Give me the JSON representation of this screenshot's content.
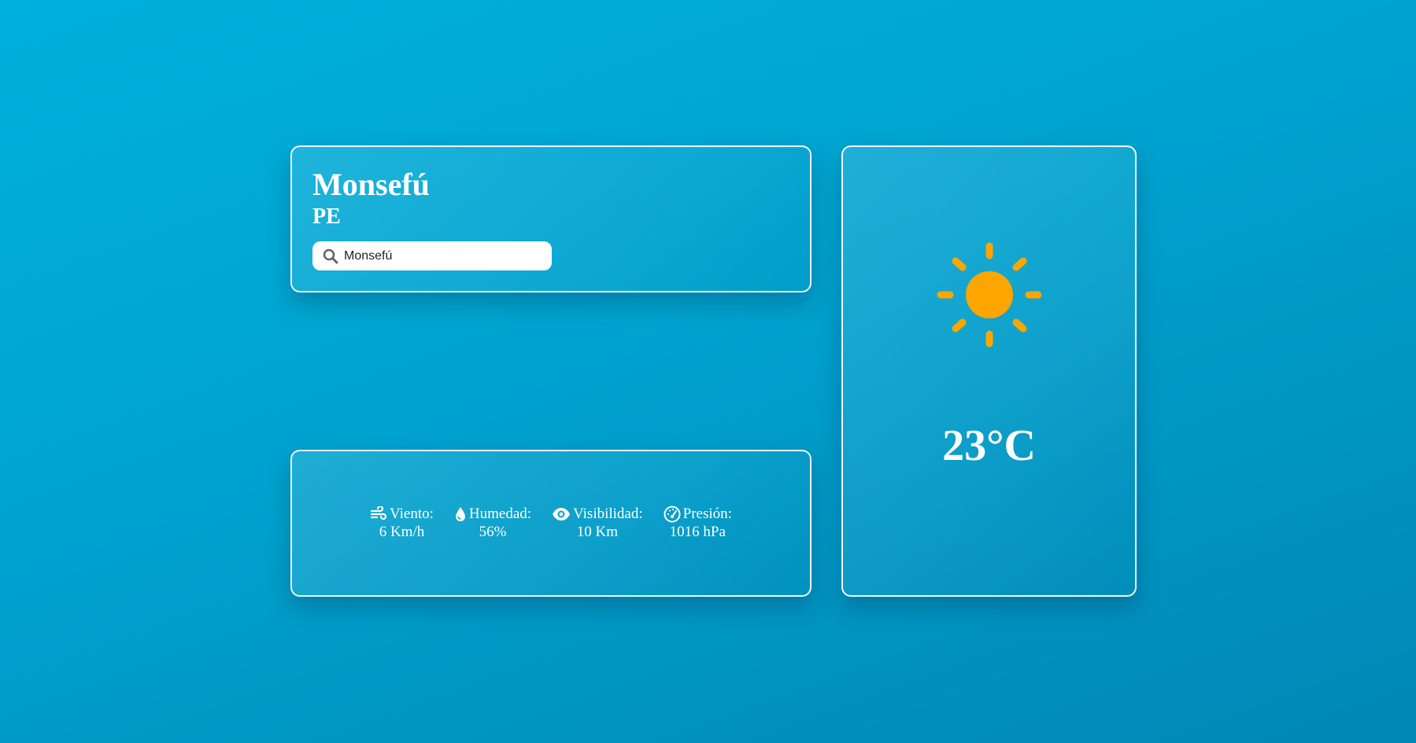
{
  "location": {
    "city": "Monsefú",
    "country": "PE",
    "search_value": "Monsefú",
    "search_icon": "magnifier-icon"
  },
  "details": {
    "wind": {
      "label": "Viento:",
      "value": "6 Km/h",
      "icon": "wind-icon"
    },
    "humidity": {
      "label": "Humedad:",
      "value": "56%",
      "icon": "droplet-icon"
    },
    "visibility": {
      "label": "Visibilidad:",
      "value": "10 Km",
      "icon": "eye-icon"
    },
    "pressure": {
      "label": "Presión:",
      "value": "1016 hPa",
      "icon": "gauge-icon"
    }
  },
  "current": {
    "condition_icon": "sun-icon",
    "temperature": "23°C"
  },
  "colors": {
    "background_top": "#00b0dc",
    "background_bottom": "#0087b5",
    "sun": "#ffa500",
    "card_border": "#ffffff"
  }
}
